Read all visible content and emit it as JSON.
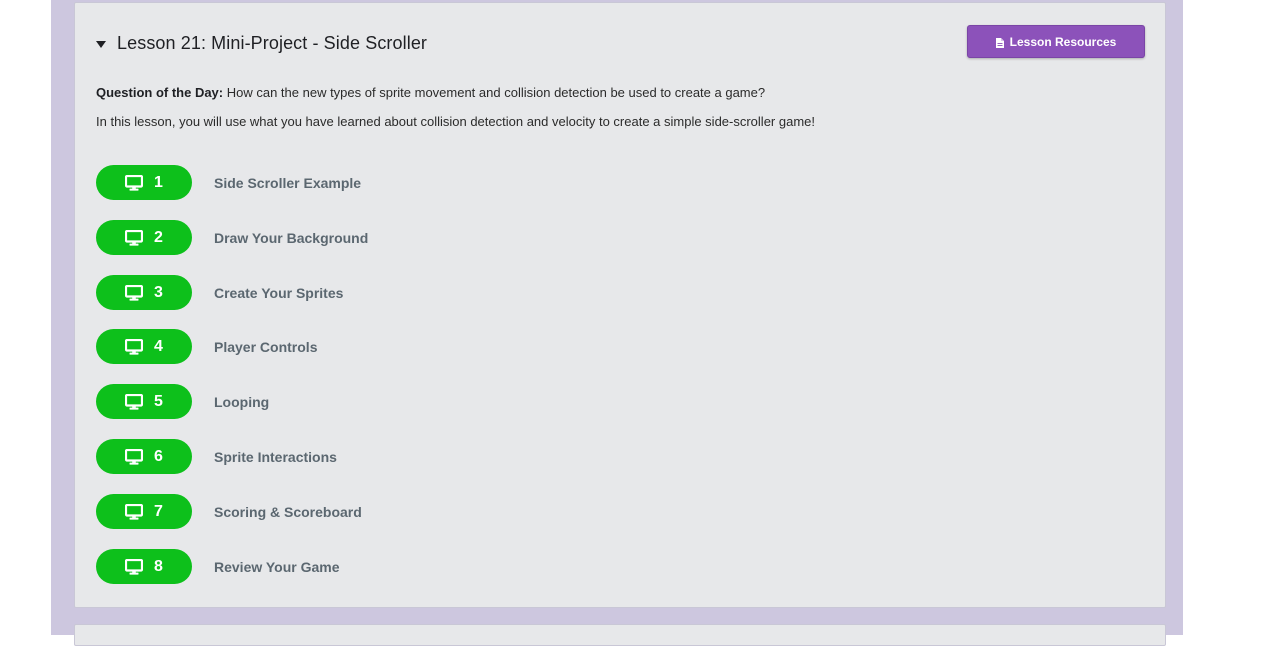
{
  "lesson": {
    "title": "Lesson 21: Mini-Project - Side Scroller",
    "resources_label": "Lesson Resources",
    "question_label": "Question of the Day:",
    "question_text": " How can the new types of sprite movement and collision detection be used to create a game?",
    "description": "In this lesson, you will use what you have learned about collision detection and velocity to create a simple side-scroller game!"
  },
  "levels": [
    {
      "number": "1",
      "label": "Side Scroller Example"
    },
    {
      "number": "2",
      "label": "Draw Your Background"
    },
    {
      "number": "3",
      "label": "Create Your Sprites"
    },
    {
      "number": "4",
      "label": "Player Controls"
    },
    {
      "number": "5",
      "label": "Looping"
    },
    {
      "number": "6",
      "label": "Sprite Interactions"
    },
    {
      "number": "7",
      "label": "Scoring & Scoreboard"
    },
    {
      "number": "8",
      "label": "Review Your Game"
    }
  ],
  "colors": {
    "bubble": "#0dc01b",
    "resources_button": "#8c52ba",
    "page_background": "#cdc7df",
    "card_background": "#e7e8ea"
  },
  "icons": {
    "level_icon": "desktop-monitor-icon",
    "resources_icon": "document-icon",
    "toggle_icon": "caret-down-icon"
  }
}
